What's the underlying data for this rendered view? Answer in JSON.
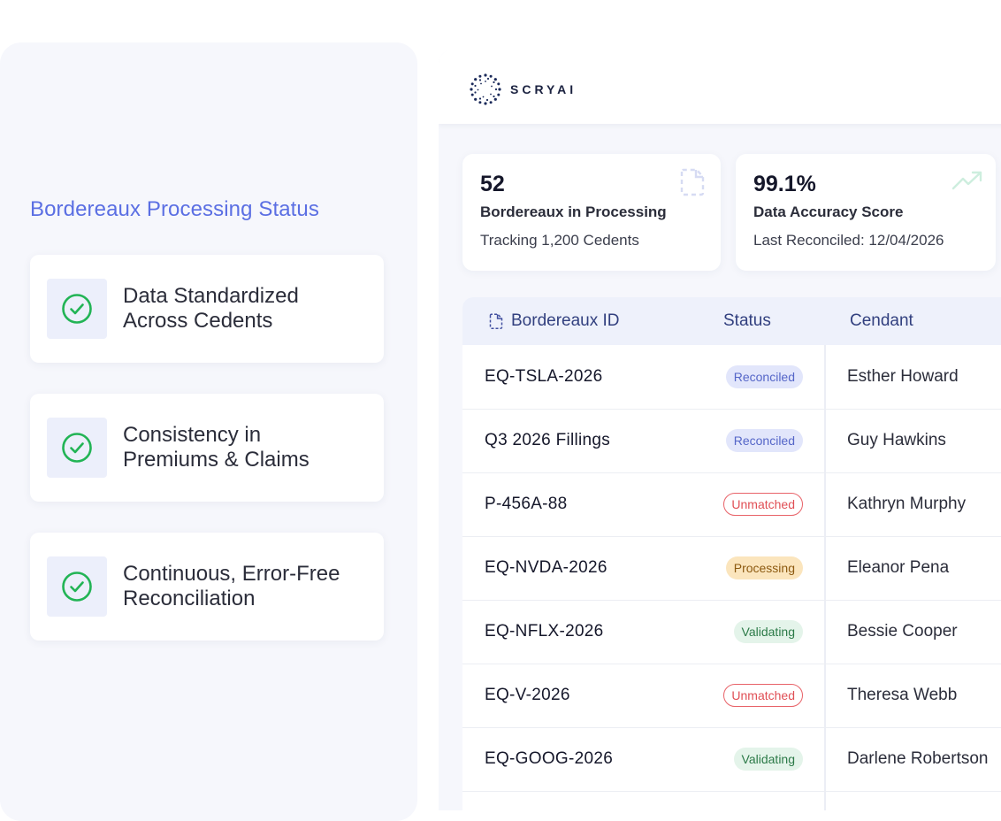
{
  "left": {
    "title": "Bordereaux Processing Status",
    "features": [
      {
        "line1": "Data Standardized",
        "line2": "Across Cedents"
      },
      {
        "line1": "Consistency in",
        "line2": "Premiums & Claims"
      },
      {
        "line1": "Continuous, Error-Free",
        "line2": "Reconciliation"
      }
    ]
  },
  "brand": {
    "name": "SCRYAI"
  },
  "stats": [
    {
      "value": "52",
      "label": "Bordereaux in Processing",
      "sub": "Tracking 1,200 Cedents",
      "icon": "document-dashed-icon"
    },
    {
      "value": "99.1%",
      "label": "Data Accuracy Score",
      "sub": "Last Reconciled: 12/04/2026",
      "icon": "trending-up-icon"
    }
  ],
  "table": {
    "headers": {
      "id": "Bordereaux ID",
      "status": "Status",
      "cedant": "Cendant"
    },
    "rows": [
      {
        "id": "EQ-TSLA-2026",
        "status": "Reconciled",
        "status_type": "reconciled",
        "cedant": "Esther Howard"
      },
      {
        "id": "Q3 2026 Fillings",
        "status": "Reconciled",
        "status_type": "reconciled",
        "cedant": "Guy Hawkins"
      },
      {
        "id": "P-456A-88",
        "status": "Unmatched",
        "status_type": "unmatched",
        "cedant": "Kathryn Murphy"
      },
      {
        "id": "EQ-NVDA-2026",
        "status": "Processing",
        "status_type": "processing",
        "cedant": "Eleanor Pena"
      },
      {
        "id": "EQ-NFLX-2026",
        "status": "Validating",
        "status_type": "validating",
        "cedant": "Bessie Cooper"
      },
      {
        "id": "EQ-V-2026",
        "status": "Unmatched",
        "status_type": "unmatched",
        "cedant": "Theresa Webb"
      },
      {
        "id": "EQ-GOOG-2026",
        "status": "Validating",
        "status_type": "validating",
        "cedant": "Darlene Robertson"
      }
    ]
  },
  "colors": {
    "accent": "#5b6fe3",
    "check_green": "#22b455",
    "panel_bg": "#f6f7fc"
  }
}
